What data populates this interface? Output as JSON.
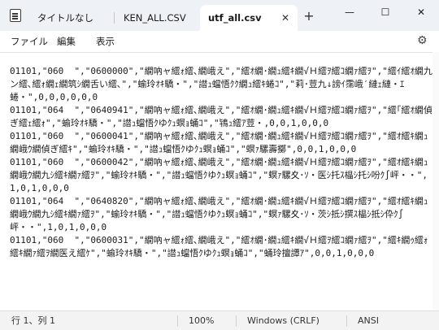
{
  "tabs": [
    {
      "label": "タイトルなし"
    },
    {
      "label": "KEN_ALL.CSV"
    },
    {
      "label": "utf_all.csv",
      "active": true
    }
  ],
  "window_controls": {
    "minimize": "—",
    "maximize": "☐",
    "close": "✕"
  },
  "new_tab_label": "+",
  "tab_close_label": "✕",
  "menu": [
    "ファイル",
    "編集",
    "表示"
  ],
  "editor": {
    "content": "01101,\"060  \",\"0600000\",\"繝吶ャ繧ｫ繧､繝峨え\",\"繧ｵ繝･繝ｭ繧ｷ繝√Ｈ繧ｦ繧ｺ繝ｧ繧ｦ\",\"繧ｲ繧ｵ繝九ン繧､繧ｫ繝ｪ繝筑ｼ繝舌い繧､\",\"蝓玲ｵｷ驕・\",\"譛ｭ蟷悟ｸｸ繝ｭ繧ｷ蜷ｺ\",\"莉･荳九↓謗ｲ霈峨′縺ｪ縺・ｴ蜷・\",0,0,0,0,0,0\n01101,\"064  \",\"0640941\",\"繝吶ャ繧ｫ繧､繝峨え\",\"繧ｵ繝･繝ｭ繧ｷ繝√Ｈ繧ｦ繧ｺ繝ｧ繧ｦ\",\"繧｢繧ｵ繝偵ぎ繧ｪ繧ｫ\",\"蝓玲ｵｷ驕・\",\"譛ｭ蟷悟ｸゆｸｭ螟ｮ蛹ｺ\",\"鴇ｭ繧ｱ荳・,0,0,1,0,0,0\n01101,\"060  \",\"0600041\",\"繝吶ャ繧ｫ繧､繝峨え\",\"繧ｵ繝･繝ｭ繧ｷ繝√Ｈ繧ｦ繧ｺ繝ｧ繧ｦ\",\"繧ｵ繧ｷ繝ｭ繝峨ｳ繝偵ぎ繧ｷ\",\"蝓玲ｵｷ驕・\",\"譛ｭ蟷悟ｸゆｸｭ螟ｮ蛹ｺ\",\"螟ｧ騾壽擲\",0,0,1,0,0,0\n01101,\"060  \",\"0600042\",\"繝吶ャ繧ｫ繧､繝峨え\",\"繧ｵ繝･繝ｭ繧ｷ繝√Ｈ繧ｦ繧ｺ繝ｧ繧ｦ\",\"繧ｵ繧ｷ繝ｭ繝峨ｳ繝九ｼ繧ｷ繝ｧ繧ｦ\",\"蝓玲ｵｷ驕・\",\"譛ｭ蟷悟ｸゆｸｭ螟ｮ蛹ｺ\",\"螟ｧ騾夊･ｿ・医ｼ托ｽ橸ｼ托ｼ吩ｸ∫岼・・\",1,0,1,0,0,0\n01101,\"064  \",\"0640820\",\"繝吶ャ繧ｫ繧､繝峨え\",\"繧ｵ繝･繝ｭ繧ｷ繝√Ｈ繧ｦ繧ｺ繝ｧ繧ｦ\",\"繧ｵ繧ｷ繝ｭ繝峨ｳ繝九ｼ繧ｷ繝ｧ繧ｦ\",\"蝓玲ｵｷ驕・\",\"譛ｭ蟷悟ｸゆｸｭ螟ｮ蛹ｺ\",\"螟ｧ騾夊･ｿ・茨ｼ抵ｼ撰ｽ橸ｼ抵ｼ伜ｸ∫岼・・\",1,0,1,0,0,0\n01101,\"060  \",\"0600031\",\"繝吶ャ繧ｫ繧､繝峨え\",\"繧ｵ繝･繝ｭ繧ｷ繝√Ｈ繧ｦ繧ｺ繝ｧ繧ｦ\",\"繧ｷ繝ｩ繧ｫ繧ｷ繝ｧ繧ｦ繝医え繧ｹ\",\"蝓玲ｵｷ驕・\",\"譛ｭ蟷悟ｸゆｸｭ螟ｮ蛹ｺ\",\"蛹玲擅譚ｱ\",0,0,1,0,0,0"
  },
  "status": {
    "position": "行 1、列 1",
    "zoom": "100%",
    "line_ending": "Windows (CRLF)",
    "encoding": "ANSI"
  }
}
